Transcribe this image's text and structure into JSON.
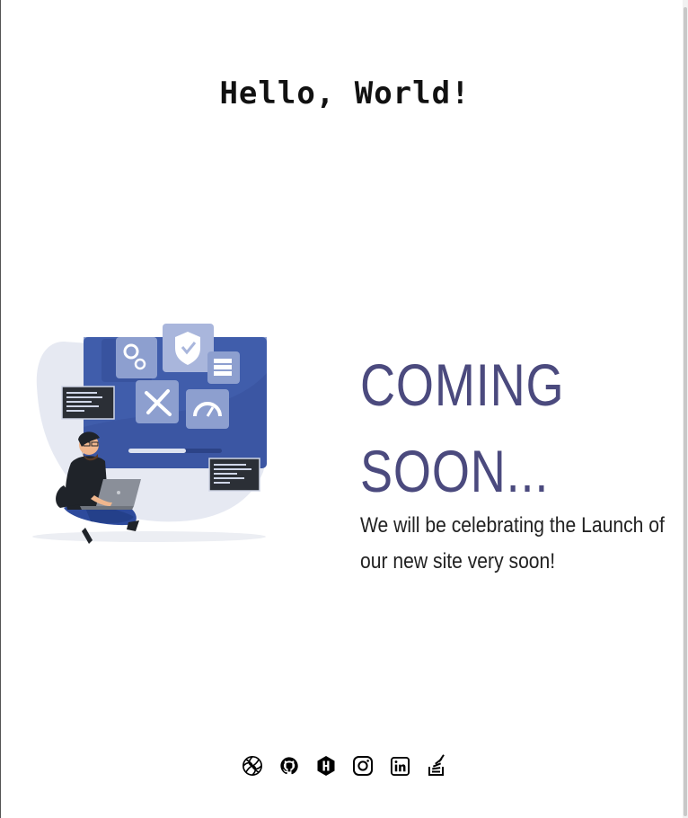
{
  "header": {
    "greeting": "Hello, World!"
  },
  "main": {
    "heading_line1": "COMING",
    "heading_line2": "SOON...",
    "message_line1": "We will be celebrating the Launch of",
    "message_line2": "our new site very soon!",
    "accent_color": "#4b4a7e",
    "illustration": "developer-working-on-laptop-illustration"
  },
  "footer": {
    "social_links": [
      {
        "icon": "codepen-swirl-icon"
      },
      {
        "icon": "github-icon"
      },
      {
        "icon": "hashnode-icon"
      },
      {
        "icon": "instagram-icon"
      },
      {
        "icon": "linkedin-icon"
      },
      {
        "icon": "stackoverflow-icon"
      }
    ]
  }
}
